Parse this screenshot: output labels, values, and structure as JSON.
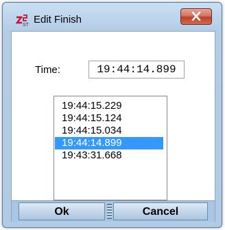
{
  "window": {
    "title": "Edit Finish"
  },
  "form": {
    "time_label": "Time:",
    "time_value": "19:44:14.899"
  },
  "list": {
    "items": [
      "19:44:15.229",
      "19:44:15.124",
      "19:44:15.034",
      "19:44:14.899",
      "19:43:31.668"
    ],
    "selected_index": 3
  },
  "buttons": {
    "ok": "Ok",
    "cancel": "Cancel"
  },
  "icons": {
    "app": "stopwatch-finish-icon",
    "close": "close-icon"
  },
  "colors": {
    "selection": "#3399ff",
    "close_button": "#c94a35"
  }
}
